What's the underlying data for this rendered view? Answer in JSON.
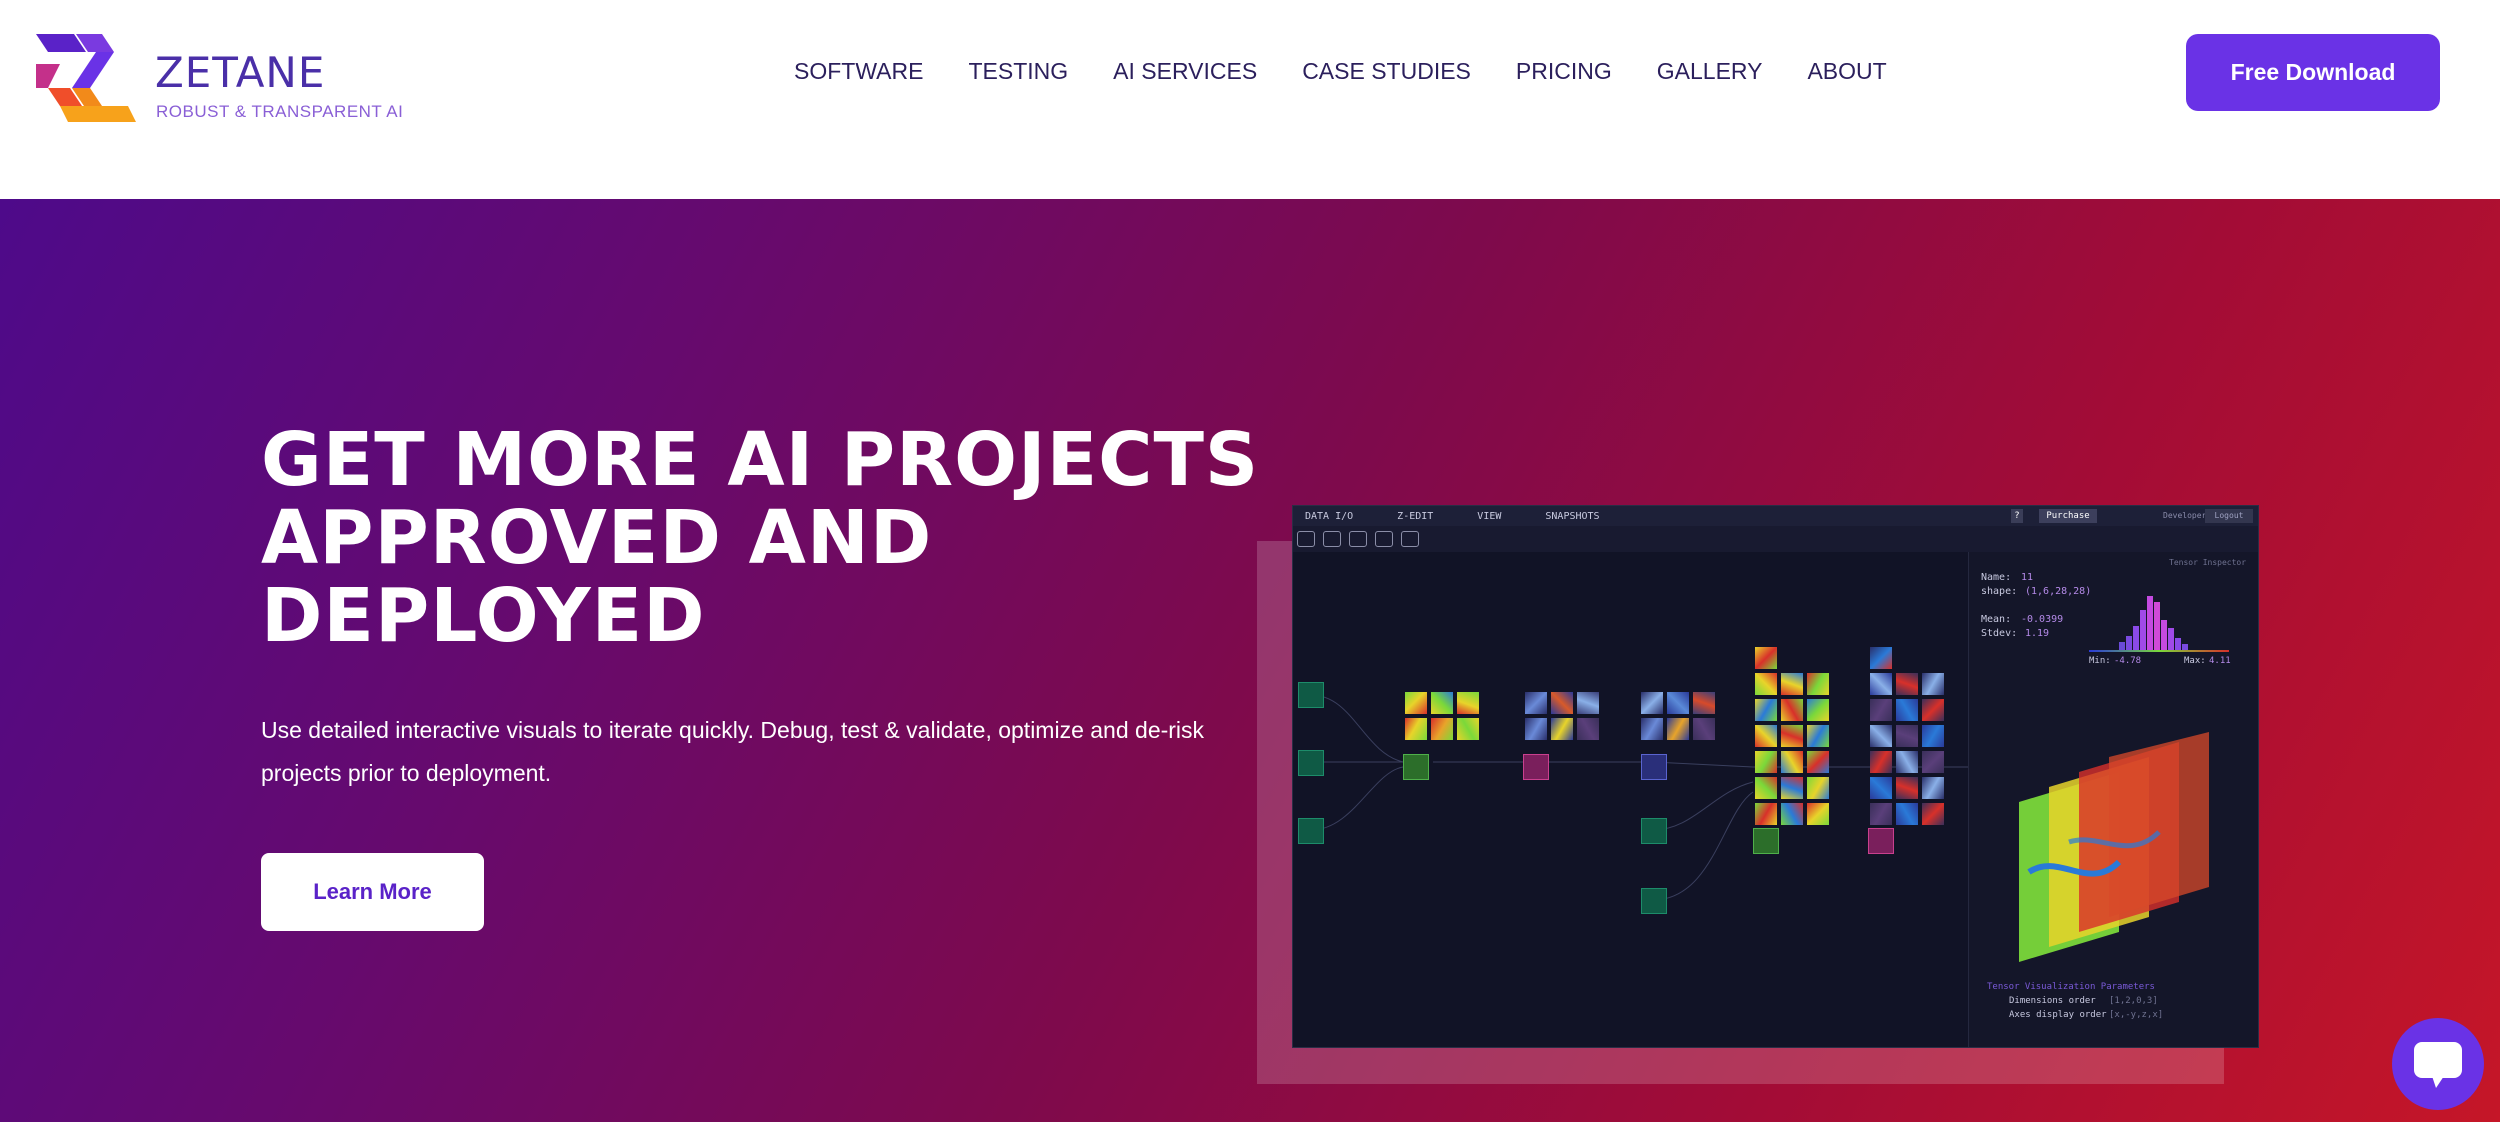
{
  "brand": {
    "name": "ZETANE",
    "tagline": "ROBUST & TRANSPARENT AI"
  },
  "nav": {
    "items": [
      {
        "label": "SOFTWARE"
      },
      {
        "label": "TESTING"
      },
      {
        "label": "AI SERVICES"
      },
      {
        "label": "CASE STUDIES"
      },
      {
        "label": "PRICING"
      },
      {
        "label": "GALLERY"
      },
      {
        "label": "ABOUT"
      }
    ],
    "cta_label": "Free Download"
  },
  "hero": {
    "title": "GET MORE AI PROJECTS APPROVED AND DEPLOYED",
    "subtitle": "Use detailed interactive visuals to iterate quickly. Debug, test & validate, optimize and de-risk projects prior to deployment.",
    "learn_more_label": "Learn More"
  },
  "app_preview": {
    "menu": [
      "DATA I/O",
      "Z-EDIT",
      "VIEW",
      "SNAPSHOTS"
    ],
    "help": "?",
    "purchase": "Purchase",
    "developer": "Developer",
    "login": "Logout",
    "inspector": {
      "title": "Tensor Inspector",
      "name_label": "Name:",
      "name_value": "11",
      "shape_label": "shape:",
      "shape_value": "(1,6,28,28)",
      "mean_label": "Mean:",
      "mean_value": "-0.0399",
      "stdev_label": "Stdev:",
      "stdev_value": "1.19",
      "min_label": "Min:",
      "min_value": "-4.78",
      "max_label": "Max:",
      "max_value": "4.11"
    },
    "viz_params": {
      "title": "Tensor Visualization Parameters",
      "dim_order_label": "Dimensions order",
      "dim_order_value": "[1,2,0,3]",
      "axes_order_label": "Axes display order",
      "axes_order_value": "[x,-y,z,x]"
    }
  },
  "colors": {
    "brand_purple": "#6a32e6",
    "nav_text": "#2b1f5c",
    "hero_gradient_start": "#4e0a8a",
    "hero_gradient_end": "#c51628"
  },
  "icons": {
    "chat": "chat-bubble-icon",
    "logo": "zetane-logo-icon"
  }
}
